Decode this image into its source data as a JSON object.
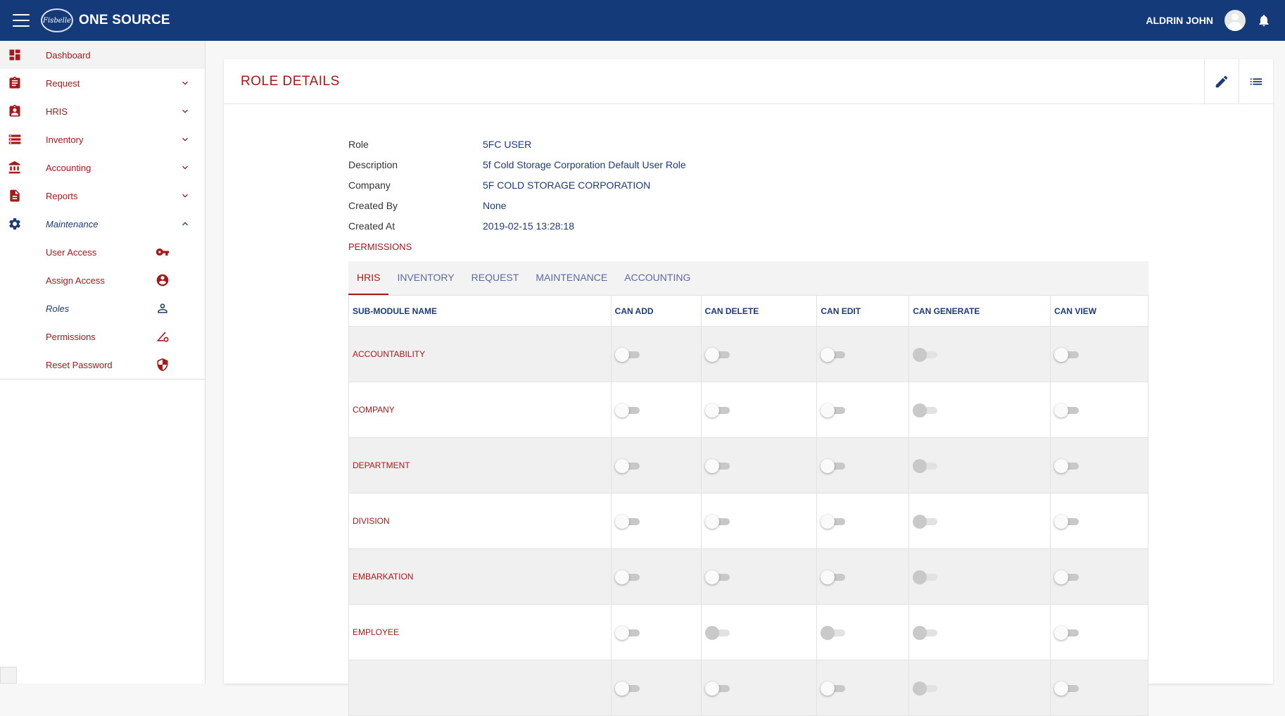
{
  "header": {
    "app_title": "ONE SOURCE",
    "logo_text": "Fisbelle",
    "username": "ALDRIN JOHN",
    "brand_color": "#143a7a"
  },
  "sidebar": {
    "items": [
      {
        "label": "Dashboard",
        "icon": "dashboard-icon"
      },
      {
        "label": "Request",
        "icon": "clipboard-icon"
      },
      {
        "label": "HRIS",
        "icon": "id-badge-icon"
      },
      {
        "label": "Inventory",
        "icon": "storage-icon"
      },
      {
        "label": "Accounting",
        "icon": "bank-icon"
      },
      {
        "label": "Reports",
        "icon": "document-icon"
      },
      {
        "label": "Maintenance",
        "icon": "gear-icon"
      }
    ],
    "sub_items": [
      {
        "label": "User Access",
        "icon": "key-icon"
      },
      {
        "label": "Assign Access",
        "icon": "account-circle-icon"
      },
      {
        "label": "Roles",
        "icon": "person-outline-icon"
      },
      {
        "label": "Permissions",
        "icon": "permissions-icon"
      },
      {
        "label": "Reset Password",
        "icon": "shield-icon"
      }
    ]
  },
  "page": {
    "title": "ROLE DETAILS",
    "details": [
      {
        "label": "Role",
        "value": "5FC USER"
      },
      {
        "label": "Description",
        "value": "5f Cold Storage Corporation Default User Role"
      },
      {
        "label": "Company",
        "value": "5F COLD STORAGE CORPORATION"
      },
      {
        "label": "Created By",
        "value": "None"
      },
      {
        "label": "Created At",
        "value": "2019-02-15 13:28:18"
      }
    ],
    "permissions_title": "PERMISSIONS",
    "tabs": [
      "HRIS",
      "INVENTORY",
      "REQUEST",
      "MAINTENANCE",
      "ACCOUNTING"
    ],
    "active_tab": "HRIS",
    "table": {
      "columns": [
        "SUB-MODULE NAME",
        "CAN ADD",
        "CAN DELETE",
        "CAN EDIT",
        "CAN GENERATE",
        "CAN VIEW"
      ],
      "rows": [
        {
          "name": "ACCOUNTABILITY",
          "perms": [
            "off",
            "off",
            "off",
            "disabled",
            "off"
          ]
        },
        {
          "name": "COMPANY",
          "perms": [
            "off",
            "off",
            "off",
            "disabled",
            "off"
          ]
        },
        {
          "name": "DEPARTMENT",
          "perms": [
            "off",
            "off",
            "off",
            "disabled",
            "off"
          ]
        },
        {
          "name": "DIVISION",
          "perms": [
            "off",
            "off",
            "off",
            "disabled",
            "off"
          ]
        },
        {
          "name": "EMBARKATION",
          "perms": [
            "off",
            "off",
            "off",
            "disabled",
            "off"
          ]
        },
        {
          "name": "EMPLOYEE",
          "perms": [
            "off",
            "disabled",
            "disabled",
            "disabled",
            "off"
          ]
        },
        {
          "name": "",
          "perms": [
            "off",
            "off",
            "off",
            "disabled",
            "off"
          ]
        }
      ]
    }
  }
}
